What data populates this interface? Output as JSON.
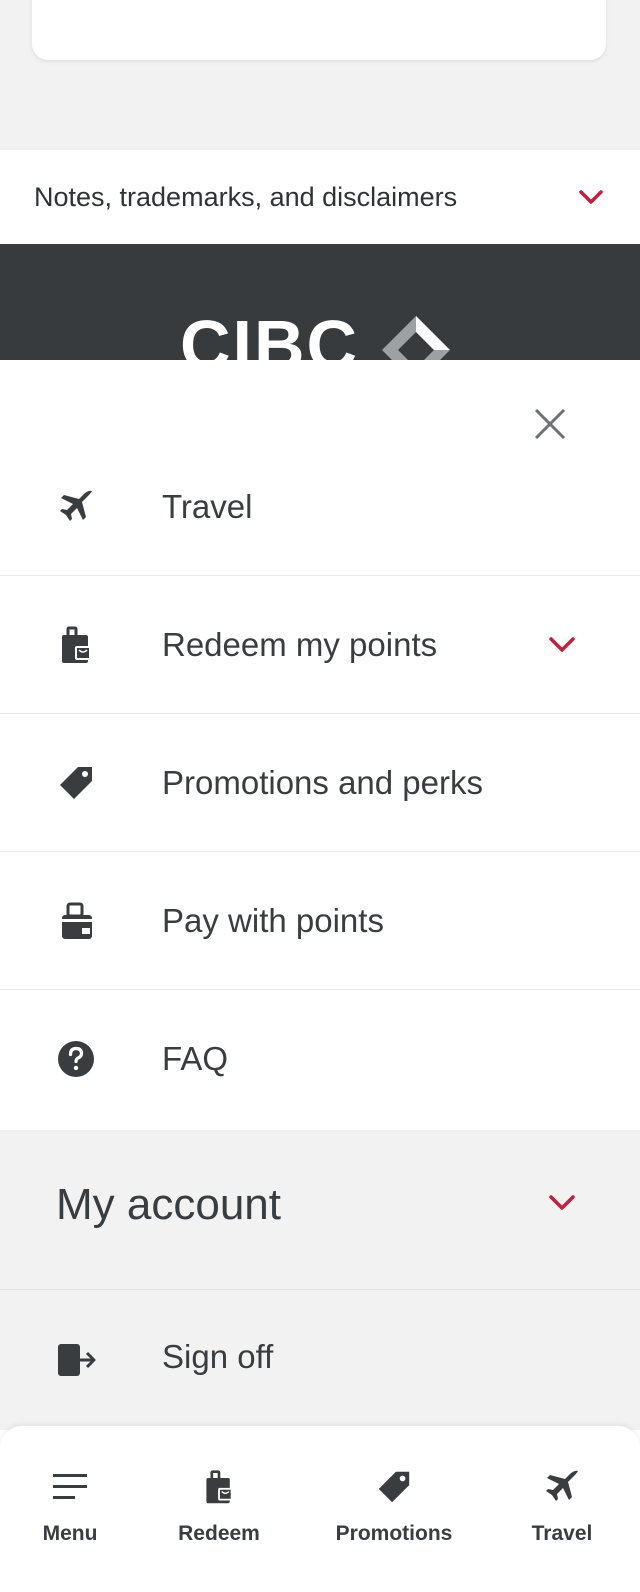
{
  "background_page": {
    "notes_label": "Notes, trademarks, and disclaimers",
    "logo_text": "CIBC"
  },
  "menu": {
    "items": [
      {
        "label": "Travel",
        "icon": "airplane-icon"
      },
      {
        "label": "Redeem my points",
        "icon": "shopping-bag-icon",
        "has_dropdown": true
      },
      {
        "label": "Promotions and perks",
        "icon": "tag-icon"
      },
      {
        "label": "Pay with points",
        "icon": "wallet-bag-icon"
      },
      {
        "label": "FAQ",
        "icon": "question-circle-icon"
      }
    ],
    "account_title": "My account",
    "sign_off_label": "Sign off"
  },
  "bottom_nav": {
    "items": [
      {
        "label": "Menu",
        "icon": "hamburger-icon"
      },
      {
        "label": "Redeem",
        "icon": "shopping-bag-icon"
      },
      {
        "label": "Promotions",
        "icon": "tag-icon"
      },
      {
        "label": "Travel",
        "icon": "airplane-icon"
      }
    ]
  },
  "colors": {
    "accent_red": "#c41f3e",
    "icon_dark": "#3a3d40",
    "footer_dark": "#383b3e"
  }
}
